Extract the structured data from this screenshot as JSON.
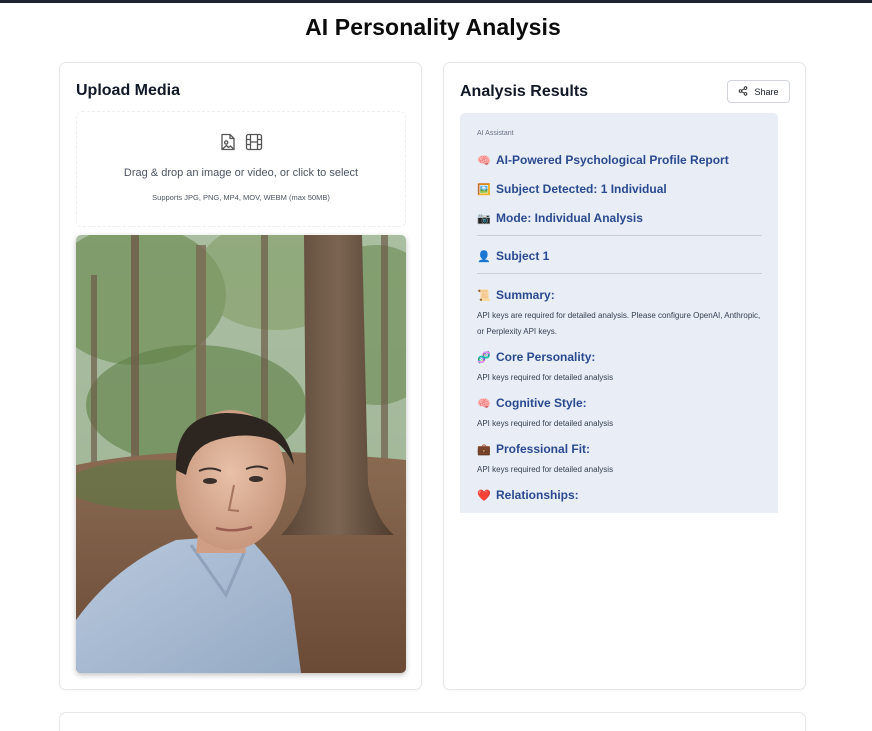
{
  "page": {
    "title": "AI Personality Analysis"
  },
  "upload": {
    "title": "Upload Media",
    "drop_text": "Drag & drop an image or video, or click to select",
    "supports_text": "Supports JPG, PNG, MP4, MOV, WEBM (max 50MB)",
    "icons": [
      "image-file-icon",
      "film-icon"
    ]
  },
  "results": {
    "title": "Analysis Results",
    "share_label": "Share",
    "assistant_label": "AI Assistant",
    "report_heading": "AI-Powered Psychological Profile Report",
    "subject_detected": "Subject Detected: 1 Individual",
    "mode": "Mode: Individual Analysis",
    "subject": "Subject 1",
    "summary_heading": "Summary:",
    "summary_text": "API keys are required for detailed analysis. Please configure OpenAI, Anthropic, or Perplexity API keys.",
    "core_heading": "Core Personality:",
    "core_text": "API keys required for detailed analysis",
    "cognitive_heading": "Cognitive Style:",
    "cognitive_text": "API keys required for detailed analysis",
    "professional_heading": "Professional Fit:",
    "professional_text": "API keys required for detailed analysis",
    "relationships_heading": "Relationships:"
  },
  "colors": {
    "accent_text": "#2a4a8f",
    "panel_bg": "#e8edf6",
    "top_bar": "#1f2330"
  }
}
